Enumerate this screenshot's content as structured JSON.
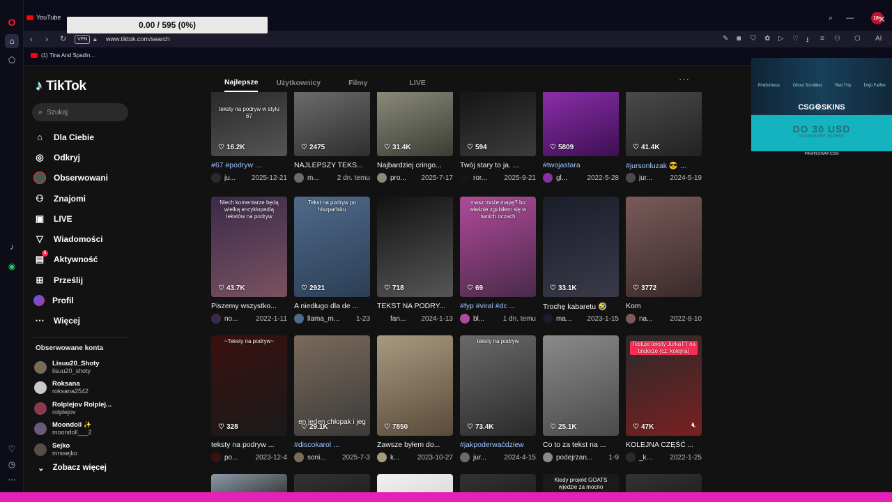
{
  "browser": {
    "tab_title": "YouTube",
    "progress_text": "0.00 / 595 (0%)",
    "badge": "18+",
    "vpn_label": "VPN",
    "url": "www.tiktok.com/search",
    "ai_label": "AI",
    "bookmark": "(1) Tina And Spadin..."
  },
  "tiktok": {
    "logo": "TikTok",
    "search_placeholder": "Szukaj",
    "menu": [
      {
        "label": "Dla Ciebie",
        "icon": "home-icon"
      },
      {
        "label": "Odkryj",
        "icon": "compass-icon"
      },
      {
        "label": "Obserwowani",
        "icon": "followed-avatar-icon"
      },
      {
        "label": "Znajomi",
        "icon": "friends-icon"
      },
      {
        "label": "LIVE",
        "icon": "live-icon"
      },
      {
        "label": "Wiadomości",
        "icon": "messages-icon"
      },
      {
        "label": "Aktywność",
        "icon": "activity-icon",
        "badge": "5"
      },
      {
        "label": "Prześlij",
        "icon": "upload-icon"
      },
      {
        "label": "Profil",
        "icon": "profile-icon"
      },
      {
        "label": "Więcej",
        "icon": "more-icon"
      }
    ],
    "following_title": "Obserwowane konta",
    "following": [
      {
        "name": "Lisuu20_Shoty",
        "handle": "lisuu20_shoty"
      },
      {
        "name": "Roksana",
        "handle": "roksana2542"
      },
      {
        "name": "Rolplejov Rolplej...",
        "handle": "rolplejov"
      },
      {
        "name": "Moondoll ✨",
        "handle": "moondoll___2"
      },
      {
        "name": "Sejko",
        "handle": "mrssejko"
      }
    ],
    "see_more": "Zobacz więcej",
    "tabs": [
      "Najlepsze",
      "Użytkownicy",
      "Filmy",
      "LIVE"
    ],
    "videos": [
      {
        "likes": "16.2K",
        "caption": "#67 #podryw ...",
        "caption_tag": true,
        "user": "ju...",
        "date": "2025-12-21",
        "overlay": "teksty na podryw w stylu 67",
        "colors": [
          "#2a2a2a",
          "#555"
        ]
      },
      {
        "likes": "2475",
        "caption": "NAJLEPSZY TEKS...",
        "caption_tag": false,
        "user": "m...",
        "date": "2 dn. temu",
        "overlay": "",
        "colors": [
          "#6b6b6b",
          "#2e2e2e"
        ]
      },
      {
        "likes": "31.4K",
        "caption": "Najbardziej cringo...",
        "caption_tag": false,
        "user": "pro...",
        "date": "2025-7-17",
        "overlay": "",
        "colors": [
          "#8a8a78",
          "#3a3d36"
        ]
      },
      {
        "likes": "594",
        "caption": "Twój stary to ja. ...",
        "caption_tag": false,
        "user": "ror...",
        "date": "2025-9-21",
        "overlay": "",
        "colors": [
          "#151515",
          "#3c3c3c"
        ]
      },
      {
        "likes": "5809",
        "caption": "#twojastara",
        "caption_tag": true,
        "user": "gl...",
        "date": "2022-5-28",
        "overlay": "",
        "colors": [
          "#8a2ea8",
          "#3d0f52"
        ]
      },
      {
        "likes": "41.4K",
        "caption": "#jursonluzak 😎 ...",
        "caption_tag": true,
        "user": "jur...",
        "date": "2024-5-19",
        "overlay": "",
        "colors": [
          "#4a4a4a",
          "#222"
        ]
      },
      {
        "likes": "43.7K",
        "caption": "Piszemy wszystko...",
        "caption_tag": false,
        "user": "no...",
        "date": "2022-1-11",
        "overlay": "Niech komentarze będą wielką encyklopedią tekstów na podryw",
        "colors": [
          "#3b2a4a",
          "#7a5260"
        ]
      },
      {
        "likes": "2921",
        "caption": "A niedługo dla de ...",
        "caption_tag": false,
        "user": "llama_m...",
        "date": "1-23",
        "overlay": "Tekst na podryw po hiszpańsku",
        "colors": [
          "#4f6a8a",
          "#2b3e55"
        ]
      },
      {
        "likes": "718",
        "caption": "TEKST NA PODRY...",
        "caption_tag": false,
        "user": "fan...",
        "date": "2024-1-13",
        "overlay": "",
        "colors": [
          "#121212",
          "#565656"
        ]
      },
      {
        "likes": "69",
        "caption": "#fyp #viral #dc ...",
        "caption_tag": true,
        "user": "bl...",
        "date": "1 dn. temu",
        "overlay": "masz może mapę? bo właśnie zgubiłem się w twoich oczach",
        "colors": [
          "#b04a9a",
          "#4a2a4a"
        ]
      },
      {
        "likes": "33.1K",
        "caption": "Trochę kabaretu 🤣",
        "caption_tag": false,
        "user": "ma...",
        "date": "2023-1-15",
        "overlay": "",
        "colors": [
          "#1a1d2a",
          "#3a3a48"
        ]
      },
      {
        "likes": "3772",
        "caption": "Kom",
        "caption_tag": false,
        "user": "na...",
        "date": "2022-8-10",
        "overlay": "",
        "colors": [
          "#7a5a5a",
          "#3a2a2a"
        ]
      },
      {
        "likes": "328",
        "caption": "teksty na podryw ...",
        "caption_tag": false,
        "user": "po...",
        "date": "2023-12-4",
        "overlay": "~Teksty na podryw~",
        "colors": [
          "#3a1010",
          "#1a1a1a"
        ]
      },
      {
        "likes": "29.1K",
        "caption": "#discokarol ...",
        "caption_tag": true,
        "user": "soni...",
        "date": "2025-7-3",
        "overlay": "en jeden chłopak i jeg",
        "colors": [
          "#7a6a5a",
          "#3a3a3a"
        ]
      },
      {
        "likes": "7850",
        "caption": "Zawsze byłem do...",
        "caption_tag": false,
        "user": "k...",
        "date": "2023-10-27",
        "overlay": "",
        "colors": [
          "#a89a80",
          "#5a4a3a"
        ]
      },
      {
        "likes": "73.4K",
        "caption": "#jakpoderwaćdziew",
        "caption_tag": true,
        "user": "jur...",
        "date": "2024-4-15",
        "overlay": "teksty na podryw",
        "colors": [
          "#6a6a6a",
          "#2a2a2a"
        ]
      },
      {
        "likes": "25.1K",
        "caption": "Co to za tekst na ...",
        "caption_tag": false,
        "user": "podejrzan...",
        "date": "1-9",
        "overlay": "",
        "colors": [
          "#8a8a8a",
          "#4a4a4a"
        ]
      },
      {
        "likes": "47K",
        "caption": "KOLEJNA CZĘŚĆ ...",
        "caption_tag": false,
        "user": "_k...",
        "date": "2022-1-25",
        "overlay": "Testuje teksty JurkaTT na tinderze (cz. kolejna)",
        "colors": [
          "#2a2a2a",
          "#7a2020"
        ]
      },
      {
        "likes": "",
        "caption": "",
        "caption_tag": false,
        "user": "",
        "date": "",
        "overlay": "",
        "colors": [
          "#8a9aa8",
          "#3a3a3a"
        ]
      },
      {
        "likes": "",
        "caption": "",
        "caption_tag": false,
        "user": "",
        "date": "",
        "overlay": "",
        "colors": [
          "#333",
          "#222"
        ]
      },
      {
        "likes": "",
        "caption": "",
        "caption_tag": false,
        "user": "",
        "date": "",
        "overlay": "",
        "colors": [
          "#f0f0f0",
          "#ddd"
        ]
      },
      {
        "likes": "",
        "caption": "",
        "caption_tag": false,
        "user": "",
        "date": "",
        "overlay": "",
        "colors": [
          "#333",
          "#222"
        ]
      },
      {
        "likes": "",
        "caption": "",
        "caption_tag": false,
        "user": "",
        "date": "",
        "overlay": "Kiedy projekt GOATS wjedzie za mocno",
        "colors": [
          "#1a1a1a",
          "#1a1a1a"
        ]
      },
      {
        "likes": "",
        "caption": "",
        "caption_tag": false,
        "user": "",
        "date": "",
        "overlay": "",
        "colors": [
          "#333",
          "#222"
        ]
      }
    ]
  },
  "ad": {
    "items": [
      "Pinkfortress",
      "Ghost Scrubber",
      "Red Trip",
      "Dojo Fatfire"
    ],
    "brand": "CSG⚙SKINS",
    "headline": "DO 30 USD",
    "subline": "DO WYMIANY SKÓREK",
    "footer": "PIRATESWAP.COM"
  },
  "colors": {
    "accent": "#fe2c55",
    "cyan": "#25f4ee",
    "page_bg": "#121212",
    "bottom_bar": "#e520b7"
  }
}
